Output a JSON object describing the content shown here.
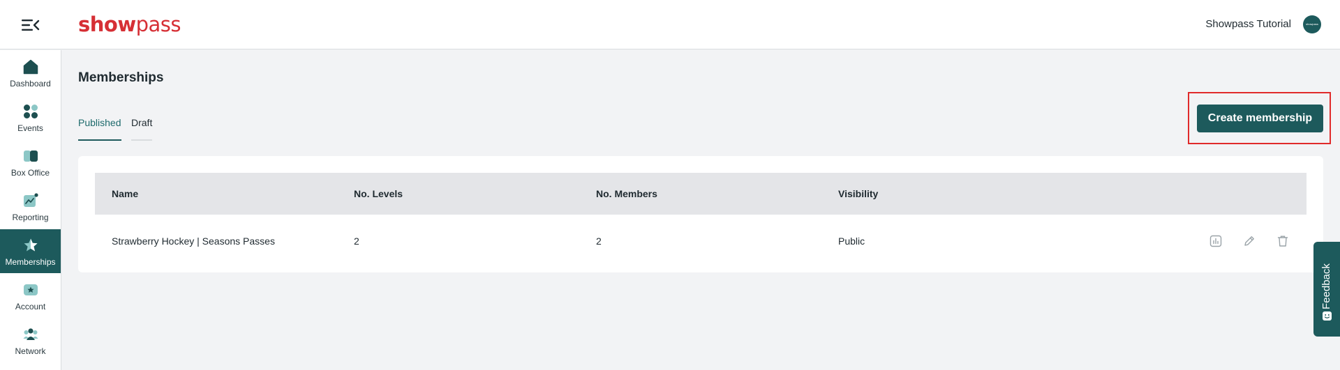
{
  "header": {
    "logo_show": "show",
    "logo_pass": "pass",
    "user_name": "Showpass Tutorial",
    "avatar_text": "showpass"
  },
  "sidebar": {
    "items": [
      {
        "label": "Dashboard",
        "icon": "home-icon"
      },
      {
        "label": "Events",
        "icon": "grid-icon"
      },
      {
        "label": "Box Office",
        "icon": "box-office-icon"
      },
      {
        "label": "Reporting",
        "icon": "chart-icon"
      },
      {
        "label": "Memberships",
        "icon": "star-icon",
        "active": true
      },
      {
        "label": "Account",
        "icon": "account-icon"
      },
      {
        "label": "Network",
        "icon": "network-icon"
      }
    ]
  },
  "main": {
    "title": "Memberships",
    "tabs": [
      {
        "label": "Published",
        "active": true
      },
      {
        "label": "Draft",
        "active": false
      }
    ],
    "create_button": "Create membership",
    "table": {
      "headers": [
        "Name",
        "No. Levels",
        "No. Members",
        "Visibility"
      ],
      "rows": [
        {
          "name": "Strawberry Hockey | Seasons Passes",
          "levels": "2",
          "members": "2",
          "visibility": "Public",
          "actions": [
            "report-icon",
            "edit-icon",
            "delete-icon"
          ]
        }
      ]
    }
  },
  "feedback": {
    "label": "Feedback"
  },
  "colors": {
    "brand": "#d62f35",
    "primary": "#1d5a5c",
    "highlight_frame": "#e02a2a"
  }
}
